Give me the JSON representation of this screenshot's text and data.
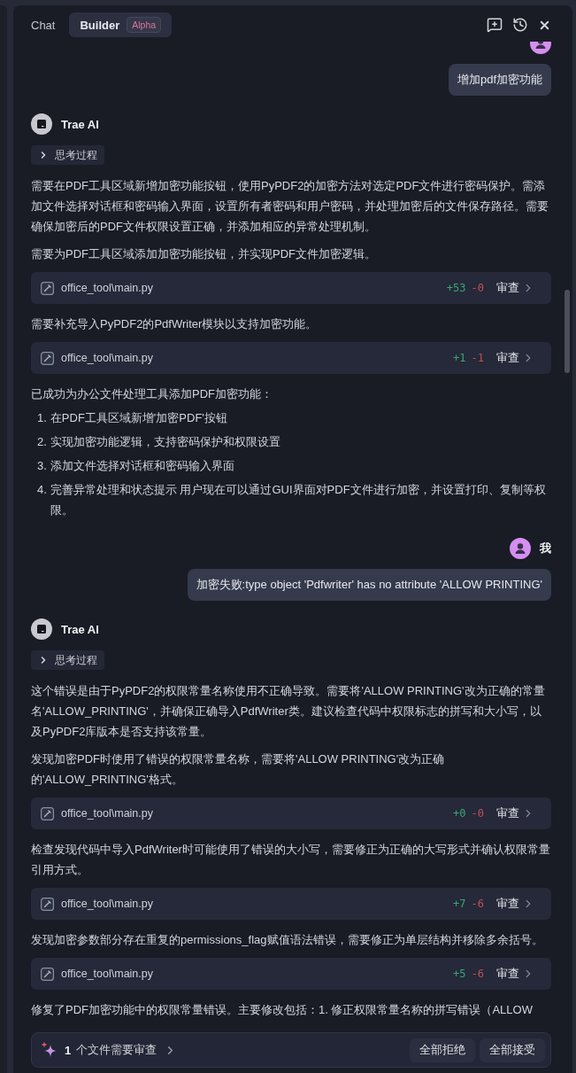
{
  "header": {
    "tabs": [
      {
        "label": "Chat",
        "selected": false
      },
      {
        "label": "Builder",
        "selected": true,
        "badge": "Alpha"
      }
    ]
  },
  "messages": [
    {
      "kind": "user",
      "text": "增加pdf加密功能"
    },
    {
      "kind": "assistant",
      "author": "Trae AI",
      "thinking": {
        "label": "思考过程",
        "expanded": false
      },
      "blocks": [
        {
          "kind": "paragraph",
          "text": "需要在PDF工具区域新增加密功能按钮，使用PyPDF2的加密方法对选定PDF文件进行密码保护。需添加文件选择对话框和密码输入界面，设置所有者密码和用户密码，并处理加密后的文件保存路径。需要确保加密后的PDF文件权限设置正确，并添加相应的异常处理机制。"
        },
        {
          "kind": "paragraph",
          "text": "需要为PDF工具区域添加加密功能按钮，并实现PDF文件加密逻辑。"
        },
        {
          "kind": "file",
          "path": "office_tool\\main.py",
          "added": "+53",
          "removed": "-0",
          "action": "审查"
        },
        {
          "kind": "paragraph",
          "text": "需要补充导入PyPDF2的PdfWriter模块以支持加密功能。"
        },
        {
          "kind": "file",
          "path": "office_tool\\main.py",
          "added": "+1",
          "removed": "-1",
          "action": "审查"
        },
        {
          "kind": "list",
          "intro": "已成功为办公文件处理工具添加PDF加密功能：",
          "items": [
            {
              "number": "1.",
              "text": "在PDF工具区域新增'加密PDF'按钮"
            },
            {
              "number": "2.",
              "text": "实现加密功能逻辑，支持密码保护和权限设置"
            },
            {
              "number": "3.",
              "text": "添加文件选择对话框和密码输入界面"
            },
            {
              "number": "4.",
              "text": "完善异常处理和状态提示 用户现在可以通过GUI界面对PDF文件进行加密，并设置打印、复制等权限。"
            }
          ]
        }
      ]
    },
    {
      "kind": "user",
      "author": "我",
      "text": "加密失败:type object 'Pdfwriter' has no attribute 'ALLOW PRINTING'"
    },
    {
      "kind": "assistant",
      "author": "Trae AI",
      "thinking": {
        "label": "思考过程",
        "expanded": false
      },
      "blocks": [
        {
          "kind": "paragraph",
          "text": "这个错误是由于PyPDF2的权限常量名称使用不正确导致。需要将'ALLOW PRINTING'改为正确的常量名'ALLOW_PRINTING'，并确保正确导入PdfWriter类。建议检查代码中权限标志的拼写和大小写，以及PyPDF2库版本是否支持该常量。"
        },
        {
          "kind": "paragraph",
          "text": "发现加密PDF时使用了错误的权限常量名称，需要将'ALLOW PRINTING'改为正确的'ALLOW_PRINTING'格式。"
        },
        {
          "kind": "file",
          "path": "office_tool\\main.py",
          "added": "+0",
          "removed": "-0",
          "action": "审查"
        },
        {
          "kind": "paragraph",
          "text": "检查发现代码中导入PdfWriter时可能使用了错误的大小写，需要修正为正确的大写形式并确认权限常量引用方式。"
        },
        {
          "kind": "file",
          "path": "office_tool\\main.py",
          "added": "+7",
          "removed": "-6",
          "action": "审查"
        },
        {
          "kind": "paragraph",
          "text": "发现加密参数部分存在重复的permissions_flag赋值语法错误，需要修正为单层结构并移除多余括号。"
        },
        {
          "kind": "file",
          "path": "office_tool\\main.py",
          "added": "+5",
          "removed": "-6",
          "action": "审查"
        },
        {
          "kind": "paragraph",
          "text": "修复了PDF加密功能中的权限常量错误。主要修改包括：1. 修正权限常量名称的拼写错误（ALLOW"
        }
      ]
    }
  ],
  "review_bar": {
    "count": "1",
    "label": "个文件需要审查",
    "buttons": [
      "全部拒绝",
      "全部接受"
    ]
  }
}
